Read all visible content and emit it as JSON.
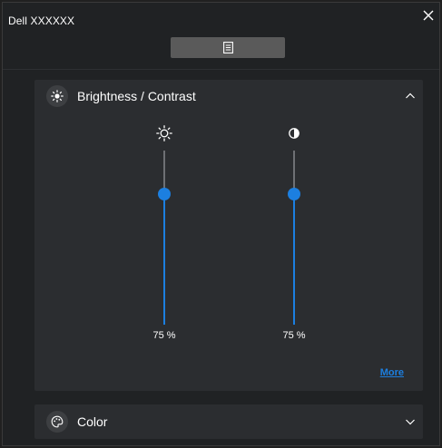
{
  "window": {
    "title": "Dell XXXXXX",
    "close_icon": "close-icon"
  },
  "toolbar": {
    "menu_icon": "document-menu-icon"
  },
  "sections": {
    "brightness_contrast": {
      "title": "Brightness / Contrast",
      "icon": "brightness-icon",
      "expanded": true,
      "sliders": {
        "brightness": {
          "icon": "sun-icon",
          "value": 75,
          "value_label": "75 %"
        },
        "contrast": {
          "icon": "contrast-icon",
          "value": 75,
          "value_label": "75 %"
        }
      },
      "more_link": "More"
    },
    "color": {
      "title": "Color",
      "icon": "palette-icon",
      "expanded": false
    }
  },
  "colors": {
    "background": "#202224",
    "panel": "#2b2d30",
    "accent": "#1c7fe0",
    "track": "#6e7074",
    "menu_button": "#5a5a5a"
  }
}
